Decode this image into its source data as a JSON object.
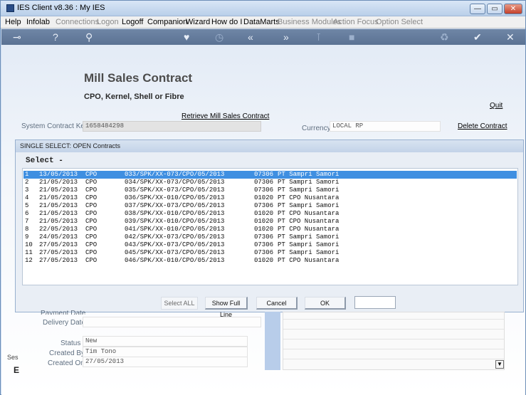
{
  "window": {
    "title": "IES Client v8.36 : My IES",
    "minimize": "—",
    "restore": "▭",
    "close": "✕"
  },
  "menu": {
    "items": [
      {
        "label": "Help",
        "enabled": true
      },
      {
        "label": "Infolab",
        "enabled": true
      },
      {
        "label": "Connections",
        "enabled": false
      },
      {
        "label": "Logon",
        "enabled": false
      },
      {
        "label": "Logoff",
        "enabled": true
      },
      {
        "label": "Companion",
        "enabled": true
      },
      {
        "label": "Wizard",
        "enabled": true
      },
      {
        "label": "How do I",
        "enabled": true
      },
      {
        "label": "DataMarts",
        "enabled": true
      },
      {
        "label": "Business Modules",
        "enabled": false
      },
      {
        "label": "Action Focus",
        "enabled": false
      },
      {
        "label": "Option Select",
        "enabled": false
      }
    ]
  },
  "toolbar": {
    "icons": [
      "key-icon",
      "help-icon",
      "search-icon",
      "heart-icon",
      "clock-icon",
      "back-icon",
      "forward-icon",
      "pin-icon",
      "stop-icon",
      "recycle-icon",
      "check-icon",
      "close-icon"
    ],
    "glyphs": [
      "⊸",
      "?",
      "⚲",
      "♥",
      "◷",
      "«",
      "»",
      "⊺",
      "■",
      "♻",
      "✔",
      "✕"
    ]
  },
  "page": {
    "title": "Mill Sales Contract",
    "subtitle": "CPO, Kernel, Shell or Fibre",
    "quit": "Quit",
    "retrieve": "Retrieve Mill Sales Contract",
    "delete": "Delete Contract",
    "system_contract_key_label": "System Contract Key",
    "system_contract_key_value": "1658484298",
    "currency_label": "Currency",
    "currency_value": "LOCAL RP",
    "payment_date_label": "Payment Date",
    "delivery_date_label": "Delivery Date",
    "status_label": "Status",
    "status_value": "New",
    "created_by_label": "Created By",
    "created_by_value": "Tim Tono",
    "created_on_label": "Created On",
    "created_on_value": "27/05/2013",
    "left_edge_text": "Ses",
    "left_edge_glyph": "E"
  },
  "modal": {
    "header": "SINGLE SELECT: OPEN Contracts",
    "select_label": "Select -",
    "rows": [
      {
        "n": "1",
        "date": "13/05/2013",
        "type": "CPO",
        "ref": "033/SPK/XX-073/CPO/05/2013",
        "code": "07306",
        "party": "PT Sampri Samori",
        "selected": true
      },
      {
        "n": "2",
        "date": "21/05/2013",
        "type": "CPO",
        "ref": "034/SPK/XX-073/CPO/05/2013",
        "code": "07306",
        "party": "PT Sampri Samori",
        "selected": false
      },
      {
        "n": "3",
        "date": "21/05/2013",
        "type": "CPO",
        "ref": "035/SPK/XX-073/CPO/05/2013",
        "code": "07306",
        "party": "PT Sampri Samori",
        "selected": false
      },
      {
        "n": "4",
        "date": "21/05/2013",
        "type": "CPO",
        "ref": "036/SPK/XX-010/CPO/05/2013",
        "code": "01020",
        "party": "PT CPO Nusantara",
        "selected": false
      },
      {
        "n": "5",
        "date": "21/05/2013",
        "type": "CPO",
        "ref": "037/SPK/XX-073/CPO/05/2013",
        "code": "07306",
        "party": "PT Sampri Samori",
        "selected": false
      },
      {
        "n": "6",
        "date": "21/05/2013",
        "type": "CPO",
        "ref": "038/SPK/XX-010/CPO/05/2013",
        "code": "01020",
        "party": "PT CPO Nusantara",
        "selected": false
      },
      {
        "n": "7",
        "date": "21/05/2013",
        "type": "CPO",
        "ref": "039/SPK/XX-010/CPO/05/2013",
        "code": "01020",
        "party": "PT CPO Nusantara",
        "selected": false
      },
      {
        "n": "8",
        "date": "22/05/2013",
        "type": "CPO",
        "ref": "041/SPK/XX-010/CPO/05/2013",
        "code": "01020",
        "party": "PT CPO Nusantara",
        "selected": false
      },
      {
        "n": "9",
        "date": "24/05/2013",
        "type": "CPO",
        "ref": "042/SPK/XX-073/CPO/05/2013",
        "code": "07306",
        "party": "PT Sampri Samori",
        "selected": false
      },
      {
        "n": "10",
        "date": "27/05/2013",
        "type": "CPO",
        "ref": "043/SPK/XX-073/CPO/05/2013",
        "code": "07306",
        "party": "PT Sampri Samori",
        "selected": false
      },
      {
        "n": "11",
        "date": "27/05/2013",
        "type": "CPO",
        "ref": "045/SPK/XX-073/CPO/05/2013",
        "code": "07306",
        "party": "PT Sampri Samori",
        "selected": false
      },
      {
        "n": "12",
        "date": "27/05/2013",
        "type": "CPO",
        "ref": "046/SPK/XX-010/CPO/05/2013",
        "code": "01020",
        "party": "PT CPO Nusantara",
        "selected": false
      }
    ],
    "buttons": {
      "select_all": "Select ALL",
      "show_full_line": "Show Full Line",
      "cancel": "Cancel",
      "ok": "OK"
    }
  },
  "colors": {
    "selection": "#3f8fe1",
    "toolbar": "#5b7293",
    "panel_blue": "#b8cdea"
  }
}
